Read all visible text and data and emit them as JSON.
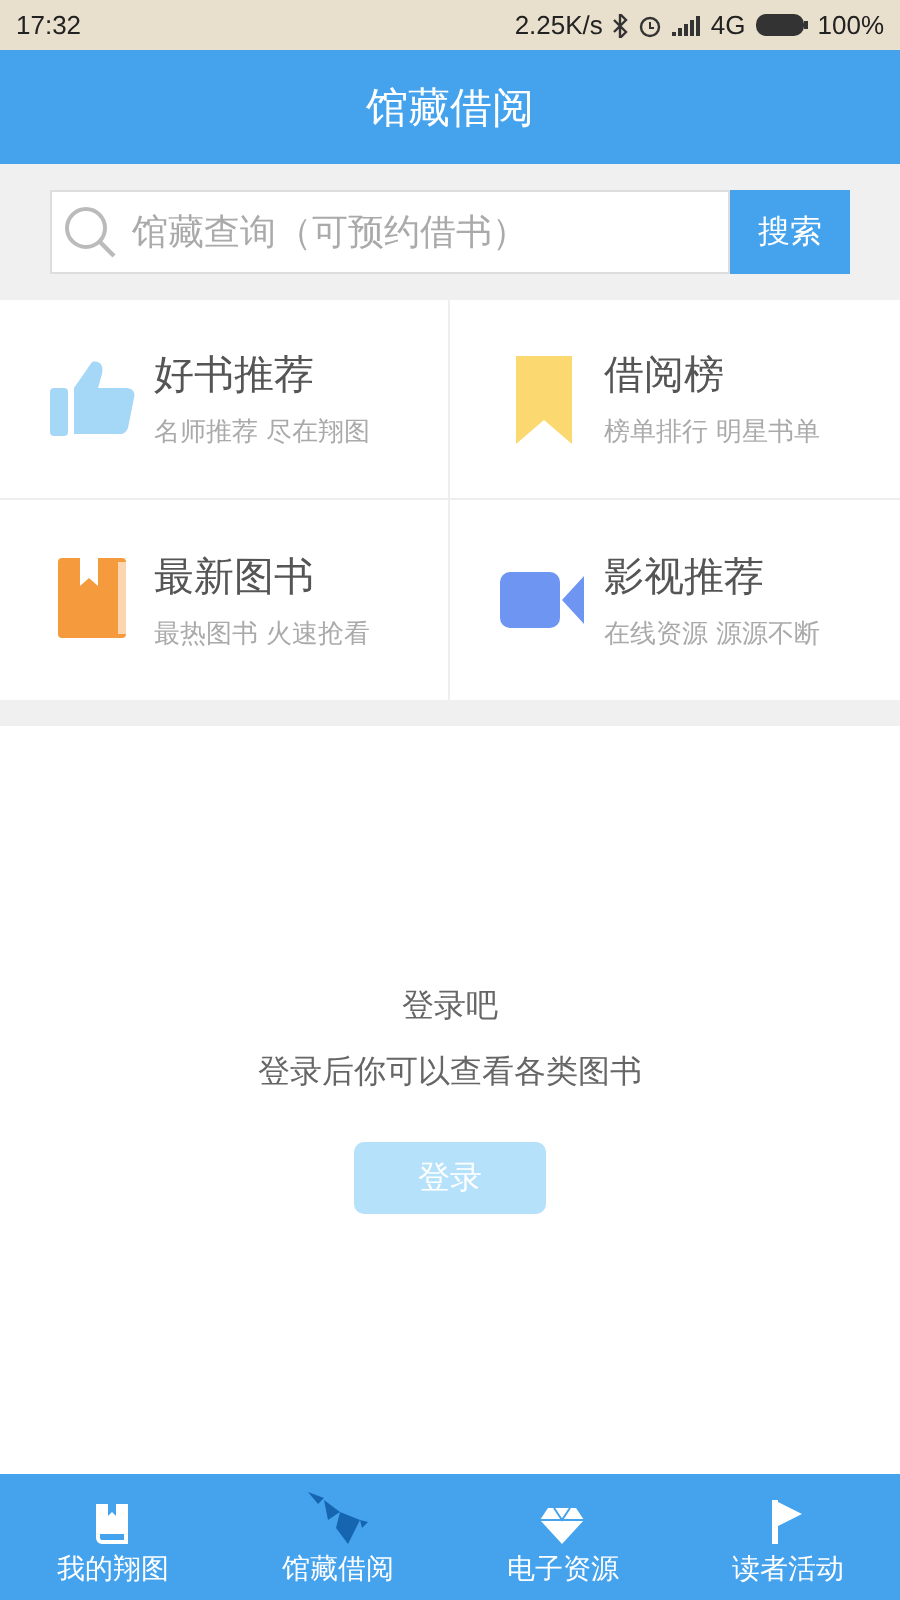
{
  "status_bar": {
    "time": "17:32",
    "speed": "2.25K/s",
    "network": "4G",
    "battery": "100%"
  },
  "header": {
    "title": "馆藏借阅"
  },
  "search": {
    "placeholder": "馆藏查询（可预约借书）",
    "button": "搜索"
  },
  "tiles": [
    {
      "kind": "thumb",
      "title": "好书推荐",
      "subtitle": "名师推荐 尽在翔图"
    },
    {
      "kind": "bookmark",
      "title": "借阅榜",
      "subtitle": "榜单排行 明星书单"
    },
    {
      "kind": "book",
      "title": "最新图书",
      "subtitle": "最热图书 火速抢看"
    },
    {
      "kind": "video",
      "title": "影视推荐",
      "subtitle": "在线资源 源源不断"
    }
  ],
  "login": {
    "title": "登录吧",
    "message": "登录后你可以查看各类图书",
    "button": "登录"
  },
  "tab_bar": [
    {
      "kind": "book",
      "label": "我的翔图",
      "selected": false
    },
    {
      "kind": "origami",
      "label": "馆藏借阅",
      "selected": true
    },
    {
      "kind": "diamond",
      "label": "电子资源",
      "selected": false
    },
    {
      "kind": "flag",
      "label": "读者活动",
      "selected": false
    }
  ]
}
